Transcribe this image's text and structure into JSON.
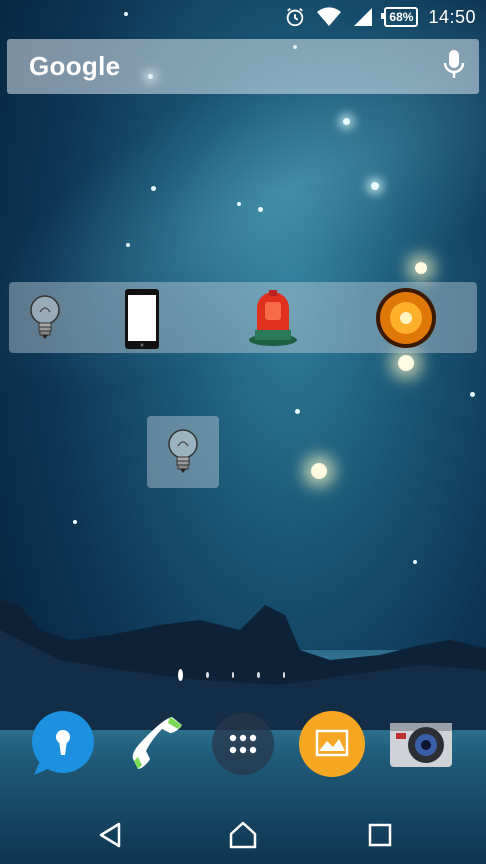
{
  "status_bar": {
    "battery_percent": "68%",
    "time": "14:50",
    "icons": [
      "alarm-icon",
      "wifi-icon",
      "cell-signal-icon",
      "battery-icon"
    ]
  },
  "search": {
    "label": "Google",
    "mic_icon": "microphone-icon"
  },
  "widget_bar": {
    "items": [
      "lightbulb-icon",
      "phone-screen-icon",
      "siren-light-icon",
      "orange-beacon-icon"
    ]
  },
  "single_widget": {
    "icon": "lightbulb-icon"
  },
  "page_indicator": {
    "count": 5,
    "active_index": 0
  },
  "dock": {
    "items": [
      "keyhole-chat-icon",
      "phone-handset-icon",
      "app-drawer-icon",
      "gallery-icon",
      "camera-icon"
    ]
  },
  "nav_bar": {
    "items": [
      "back-icon",
      "home-icon",
      "recents-icon"
    ]
  },
  "colors": {
    "dock_blue": "#1e90e0",
    "dock_orange": "#f5a623",
    "phone_green": "#7ed957"
  }
}
